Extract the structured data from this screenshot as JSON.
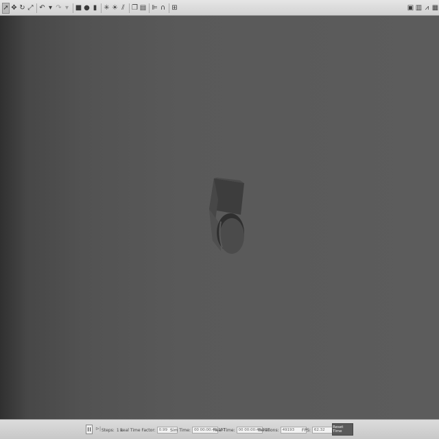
{
  "toolbar": {
    "tools": [
      {
        "icon": "arrow-select-icon",
        "glyph": "➚",
        "selected": true
      },
      {
        "icon": "translate-icon",
        "glyph": "✥"
      },
      {
        "icon": "rotate-icon",
        "glyph": "↻"
      },
      {
        "icon": "scale-icon",
        "glyph": "⤢"
      },
      {
        "sep": true
      },
      {
        "icon": "undo-icon",
        "glyph": "↶"
      },
      {
        "icon": "undo-dropdown-icon",
        "glyph": "▾"
      },
      {
        "icon": "redo-icon",
        "glyph": "↷",
        "dim": true
      },
      {
        "icon": "redo-dropdown-icon",
        "glyph": "▾",
        "dim": true
      },
      {
        "sep": true
      },
      {
        "icon": "box-shape-icon",
        "glyph": "■"
      },
      {
        "icon": "sphere-shape-icon",
        "glyph": "●"
      },
      {
        "icon": "cylinder-shape-icon",
        "glyph": "▮"
      },
      {
        "sep": true
      },
      {
        "icon": "point-light-icon",
        "glyph": "✳"
      },
      {
        "icon": "spot-light-icon",
        "glyph": "☀"
      },
      {
        "icon": "directional-light-icon",
        "glyph": "⫽"
      },
      {
        "sep": true
      },
      {
        "icon": "copy-icon",
        "glyph": "❐"
      },
      {
        "icon": "paste-icon",
        "glyph": "▤"
      },
      {
        "sep": true
      },
      {
        "icon": "align-icon",
        "glyph": "⊫"
      },
      {
        "icon": "snap-icon",
        "glyph": "∩"
      },
      {
        "sep": true
      },
      {
        "icon": "change-view-icon",
        "glyph": "⊞"
      }
    ],
    "right_tools": [
      {
        "icon": "screenshot-icon",
        "glyph": "▣"
      },
      {
        "icon": "log-icon",
        "glyph": "▥"
      },
      {
        "icon": "plot-icon",
        "glyph": "⩘"
      },
      {
        "icon": "video-record-icon",
        "glyph": "▦"
      }
    ]
  },
  "status": {
    "steps_label": "Steps:",
    "steps_value": "1",
    "real_time_factor_label": "Real Time Factor:",
    "real_time_factor_value": "0.99",
    "sim_time_label": "Sim Time:",
    "sim_time_value": "00 00:00:49.193",
    "real_time_label": "Real Time:",
    "real_time_value": "00 00:00:49.582",
    "iterations_label": "Iterations:",
    "iterations_value": "49193",
    "fps_label": "FPS:",
    "fps_value": "62.32",
    "reset_label": "Reset Time"
  },
  "scene": {
    "background_color": "#5c5c5c",
    "object_color": "#4a4a4a"
  }
}
